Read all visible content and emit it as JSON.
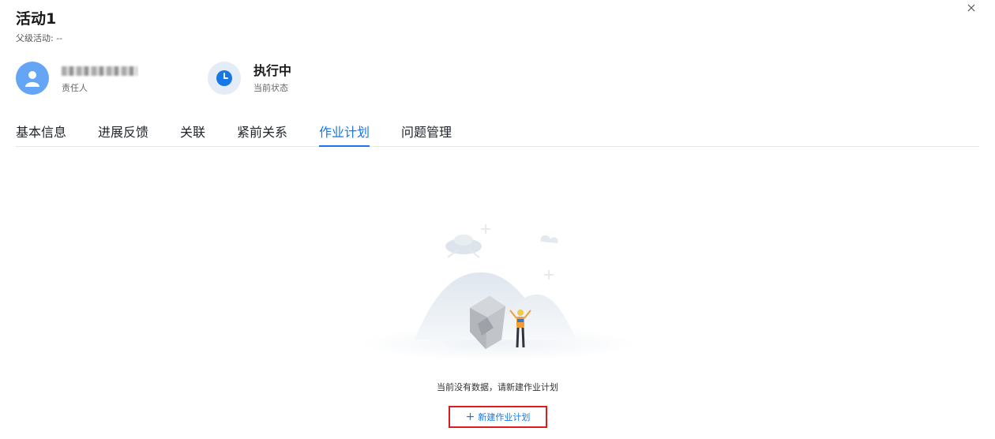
{
  "header": {
    "title": "活动1",
    "parent_label": "父级活动: --"
  },
  "owner": {
    "role_label": "责任人",
    "icon": "user-icon",
    "avatar_color": "#64a5f6"
  },
  "status": {
    "value": "执行中",
    "label": "当前状态",
    "icon": "clock-icon",
    "icon_color": "#1677e6"
  },
  "tabs": [
    {
      "label": "基本信息",
      "active": false
    },
    {
      "label": "进展反馈",
      "active": false
    },
    {
      "label": "关联",
      "active": false
    },
    {
      "label": "紧前关系",
      "active": false
    },
    {
      "label": "作业计划",
      "active": true
    },
    {
      "label": "问题管理",
      "active": false
    }
  ],
  "empty_state": {
    "message": "当前没有数据，请新建作业计划",
    "action_label": "新建作业计划",
    "action_icon": "plus-icon"
  },
  "colors": {
    "accent": "#1677e6",
    "highlight_border": "#e01b1b"
  }
}
